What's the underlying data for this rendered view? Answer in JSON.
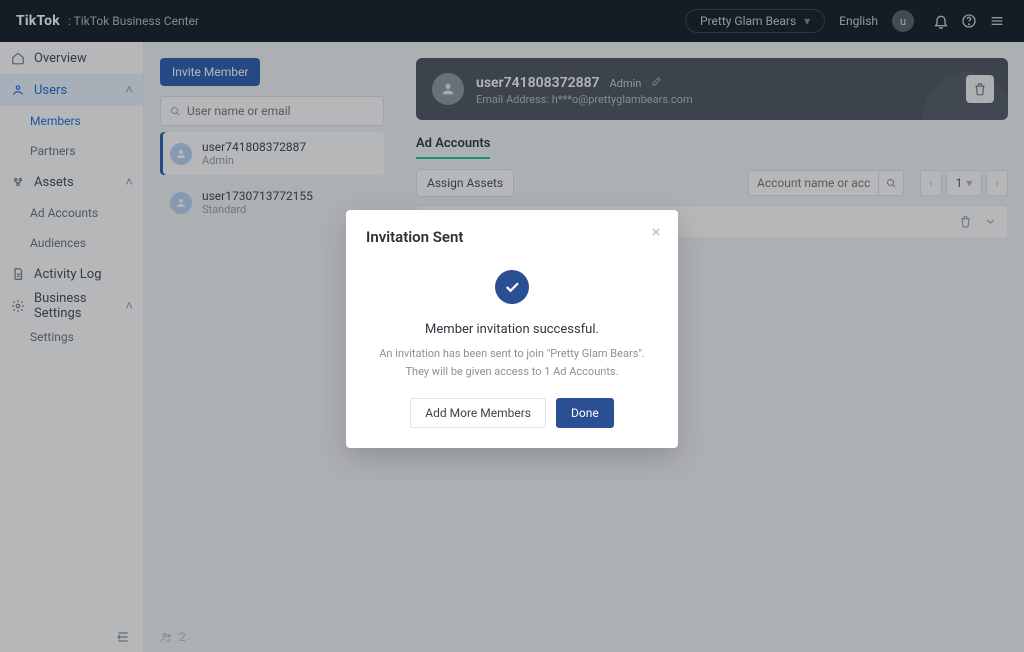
{
  "header": {
    "brand": "TikTok",
    "sub": ": TikTok Business Center",
    "org": "Pretty Glam Bears",
    "language": "English",
    "avatar_initial": "u"
  },
  "sidebar": {
    "overview": "Overview",
    "users": "Users",
    "users_items": {
      "members": "Members",
      "partners": "Partners"
    },
    "assets": "Assets",
    "assets_items": {
      "adaccounts": "Ad Accounts",
      "audiences": "Audiences"
    },
    "activity": "Activity Log",
    "settings": "Business Settings",
    "settings_items": {
      "settings": "Settings"
    }
  },
  "memberlist": {
    "invite": "Invite Member",
    "search_placeholder": "User name or email",
    "items": [
      {
        "name": "user741808372887",
        "role": "Admin"
      },
      {
        "name": "user1730713772155",
        "role": "Standard"
      }
    ],
    "footer_count": "2"
  },
  "main": {
    "user": {
      "name": "user741808372887",
      "role": "Admin",
      "email_label": "Email Address: h***o@prettyglambears.com"
    },
    "tabs": {
      "adaccounts": "Ad Accounts"
    },
    "assign": "Assign Assets",
    "acct_search_placeholder": "Account name or account",
    "page_num": "1"
  },
  "modal": {
    "title": "Invitation Sent",
    "message": "Member invitation successful.",
    "line1": "An invitation has been sent to join \"Pretty Glam Bears\".",
    "line2": "They will be given access to 1 Ad Accounts.",
    "add_more": "Add More Members",
    "done": "Done"
  }
}
